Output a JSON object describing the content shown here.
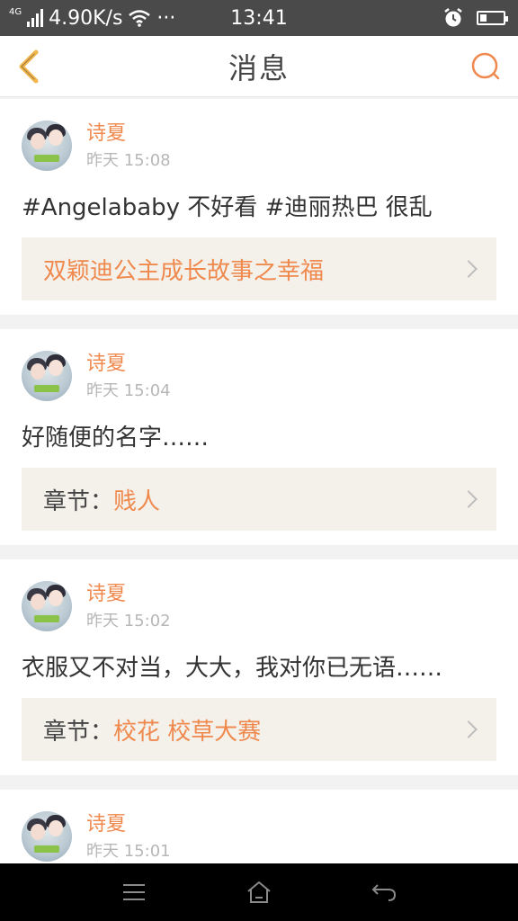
{
  "status_bar": {
    "network_type": "4G",
    "speed": "4.90K/s",
    "more": "···",
    "time": "13:41"
  },
  "header": {
    "title": "消息",
    "accent_color": "#f0894e"
  },
  "messages": [
    {
      "user": "诗夏",
      "time": "昨天 15:08",
      "comment": "#Angelababy 不好看 #迪丽热巴 很乱",
      "link_prefix": "",
      "link_text": "双颖迪公主成长故事之幸福"
    },
    {
      "user": "诗夏",
      "time": "昨天 15:04",
      "comment": "好随便的名字……",
      "link_prefix": "章节：",
      "link_text": "贱人"
    },
    {
      "user": "诗夏",
      "time": "昨天 15:02",
      "comment": "衣服又不对当，大大，我对你已无语……",
      "link_prefix": "章节：",
      "link_text": "校花 校草大赛"
    },
    {
      "user": "诗夏",
      "time": "昨天 15:01"
    }
  ],
  "nav_icons": [
    "menu-icon",
    "home-icon",
    "back-icon"
  ]
}
